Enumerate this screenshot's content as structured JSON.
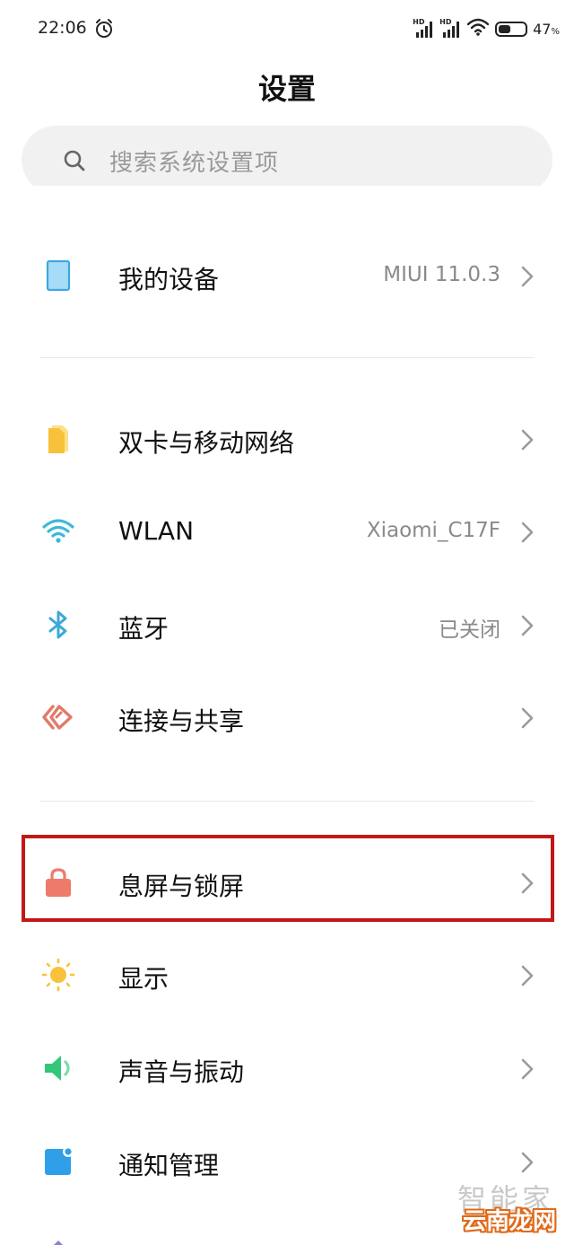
{
  "status_bar": {
    "time": "22:06",
    "signal_badge_1": "HD",
    "signal_badge_2": "HD",
    "battery_percent": "47",
    "battery_level": 0.47
  },
  "header": {
    "title": "设置"
  },
  "search": {
    "placeholder": "搜索系统设置项"
  },
  "settings": [
    {
      "label": "我的设备",
      "value": "MIUI 11.0.3",
      "icon": "tablet-icon",
      "color": "#4fb6e8"
    },
    {
      "label": "双卡与移动网络",
      "value": "",
      "icon": "sim-card-icon",
      "color": "#f7c23a"
    },
    {
      "label": "WLAN",
      "value": "Xiaomi_C17F",
      "icon": "wifi-icon",
      "color": "#3cb9d6"
    },
    {
      "label": "蓝牙",
      "value": "已关闭",
      "icon": "bluetooth-icon",
      "color": "#3ba8d8"
    },
    {
      "label": "连接与共享",
      "value": "",
      "icon": "connection-share-icon",
      "color": "#e07a6a"
    },
    {
      "label": "息屏与锁屏",
      "value": "",
      "icon": "lock-icon",
      "color": "#ee7a6a"
    },
    {
      "label": "显示",
      "value": "",
      "icon": "sun-icon",
      "color": "#f8c23a"
    },
    {
      "label": "声音与振动",
      "value": "",
      "icon": "speaker-icon",
      "color": "#34c77a"
    },
    {
      "label": "通知管理",
      "value": "",
      "icon": "notification-icon",
      "color": "#2e9fe8"
    }
  ],
  "highlight_color": "#c21818",
  "watermark": {
    "line1": "智能家",
    "line2": "云南龙网"
  }
}
